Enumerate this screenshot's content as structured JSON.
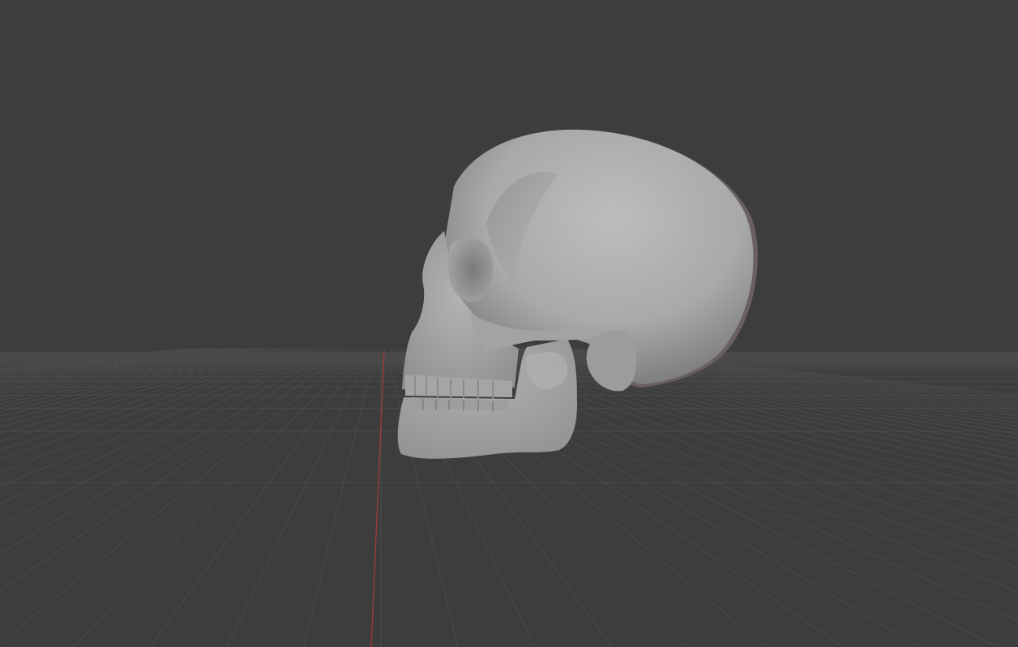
{
  "viewport": {
    "mode": "3d-viewport",
    "background_color": "#3d3d3d",
    "grid_color": "#4a4a4a",
    "axis_color": "#b03a3a",
    "object": {
      "name": "skull",
      "shading": "solid-matcap-gray",
      "base_color": "#a6a6a6"
    }
  }
}
